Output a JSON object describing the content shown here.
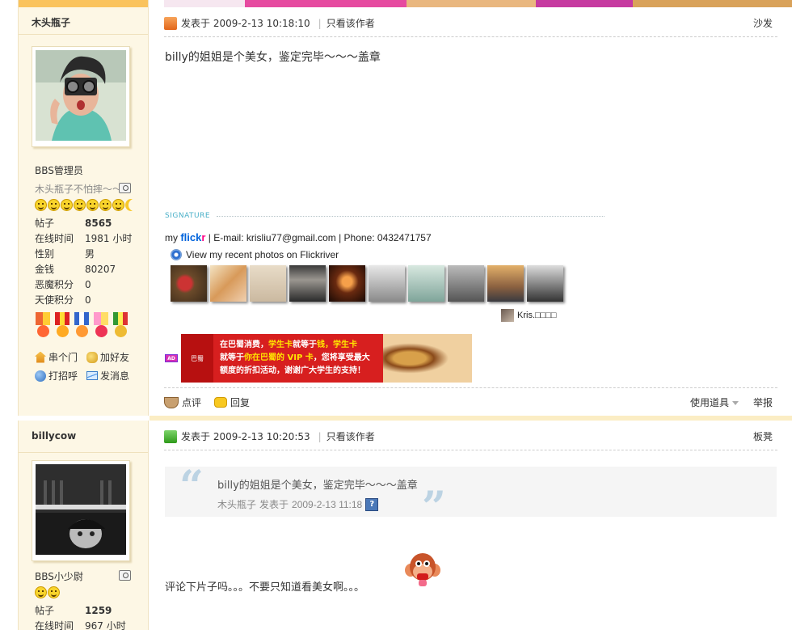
{
  "posts": [
    {
      "author": "木头瓶子",
      "user_group": "BBS管理员",
      "custom_title": "木头瓶子不怕摔～～",
      "stats": [
        {
          "label": "帖子",
          "value": "8565"
        },
        {
          "label": "在线时间",
          "value": "1981 小时"
        },
        {
          "label": "性别",
          "value": "男"
        },
        {
          "label": "金钱",
          "value": "80207"
        },
        {
          "label": "恶魔积分",
          "value": "0"
        },
        {
          "label": "天使积分",
          "value": "0"
        }
      ],
      "actions": [
        "串个门",
        "加好友",
        "打招呼",
        "发消息"
      ],
      "posted_at": "发表于 2009-2-13 10:18:10",
      "only_author": "只看该作者",
      "floor": "沙发",
      "content": "billy的姐姐是个美女，鉴定完毕～～～盖章",
      "signature_label": "SIGNATURE",
      "signature": {
        "flickr_prefix": "my",
        "flickr_name": "flick",
        "flickr_r": "r",
        "contact": " | E-mail: krisliu77@gmail.com | Phone: 0432471757",
        "flickriver_link": "View my recent photos on Flickriver",
        "kris_label": "Kris.□□□□"
      },
      "ad": {
        "badge": "AD",
        "logo_text": "巴蜀",
        "line1_a": "在巴蜀消费，",
        "line1_b": "学生卡",
        "line1_c": "就等于",
        "line1_d": "钱，学生卡",
        "line2_a": "就等于",
        "line2_b": "你在巴蜀的 VIP 卡",
        "line2_c": "，您将享受最大",
        "line3": "额度的折扣活动，谢谢广大学生的支持！"
      },
      "footer": {
        "comment": "点评",
        "reply": "回复",
        "tools": "使用道具",
        "report": "举报"
      }
    },
    {
      "author": "billycow",
      "user_group": "BBS小少尉",
      "stats": [
        {
          "label": "帖子",
          "value": "1259"
        },
        {
          "label": "在线时间",
          "value": "967 小时"
        }
      ],
      "posted_at": "发表于 2009-2-13 10:20:53",
      "only_author": "只看该作者",
      "floor": "板凳",
      "quote": {
        "text": "billy的姐姐是个美女，鉴定完毕～～～盖章",
        "author": "木头瓶子",
        "posted": "发表于",
        "date": "2009-2-13 11:18",
        "jump": "?"
      },
      "content": "评论下片子吗。。。不要只知道看美女啊。。。"
    }
  ]
}
